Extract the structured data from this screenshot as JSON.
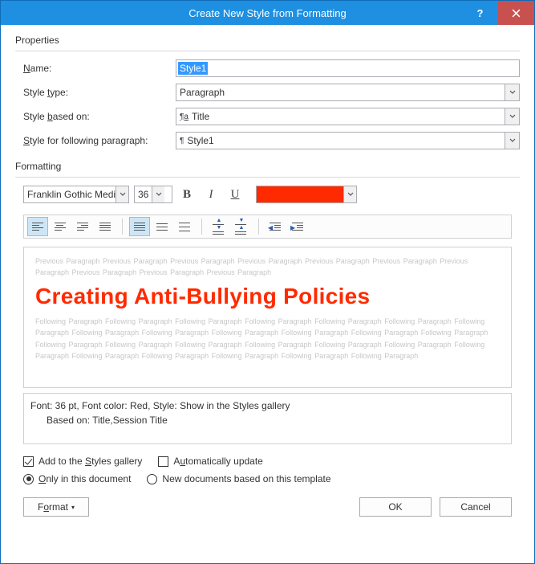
{
  "titlebar": {
    "title": "Create New Style from Formatting"
  },
  "sections": {
    "properties": "Properties",
    "formatting": "Formatting"
  },
  "labels": {
    "name_pre": "",
    "name_ul": "N",
    "name_post": "ame:",
    "type_pre": "Style ",
    "type_ul": "t",
    "type_post": "ype:",
    "based_pre": "Style ",
    "based_ul": "b",
    "based_post": "ased on:",
    "follow_pre": "",
    "follow_ul": "S",
    "follow_post": "tyle for following paragraph:"
  },
  "fields": {
    "name": "Style1",
    "type": "Paragraph",
    "based_on": "Title",
    "following": "Style1",
    "font": "Franklin Gothic Medi",
    "size": "36",
    "color": "#ff2a00"
  },
  "preview": {
    "previous": "Previous Paragraph Previous Paragraph Previous Paragraph Previous Paragraph Previous Paragraph Previous Paragraph Previous Paragraph Previous Paragraph Previous Paragraph Previous Paragraph",
    "sample": "Creating Anti-Bullying Policies",
    "following": "Following Paragraph Following Paragraph Following Paragraph Following Paragraph Following Paragraph Following Paragraph Following Paragraph Following Paragraph Following Paragraph Following Paragraph Following Paragraph Following Paragraph Following Paragraph Following Paragraph Following Paragraph Following Paragraph Following Paragraph Following Paragraph Following Paragraph Following Paragraph Following Paragraph Following Paragraph Following Paragraph Following Paragraph Following Paragraph"
  },
  "description": {
    "line1": "Font: 36 pt, Font color: Red, Style: Show in the Styles gallery",
    "line2": "Based on: Title,Session Title"
  },
  "options": {
    "add_gallery_pre": "Add to the ",
    "add_gallery_ul": "S",
    "add_gallery_post": "tyles gallery",
    "auto_update_pre": "A",
    "auto_update_ul": "u",
    "auto_update_post": "tomatically update",
    "only_doc_pre": "",
    "only_doc_ul": "O",
    "only_doc_post": "nly in this document",
    "new_docs": "New documents based on this template"
  },
  "buttons": {
    "format_pre": "F",
    "format_ul": "o",
    "format_post": "rmat",
    "ok": "OK",
    "cancel": "Cancel"
  }
}
